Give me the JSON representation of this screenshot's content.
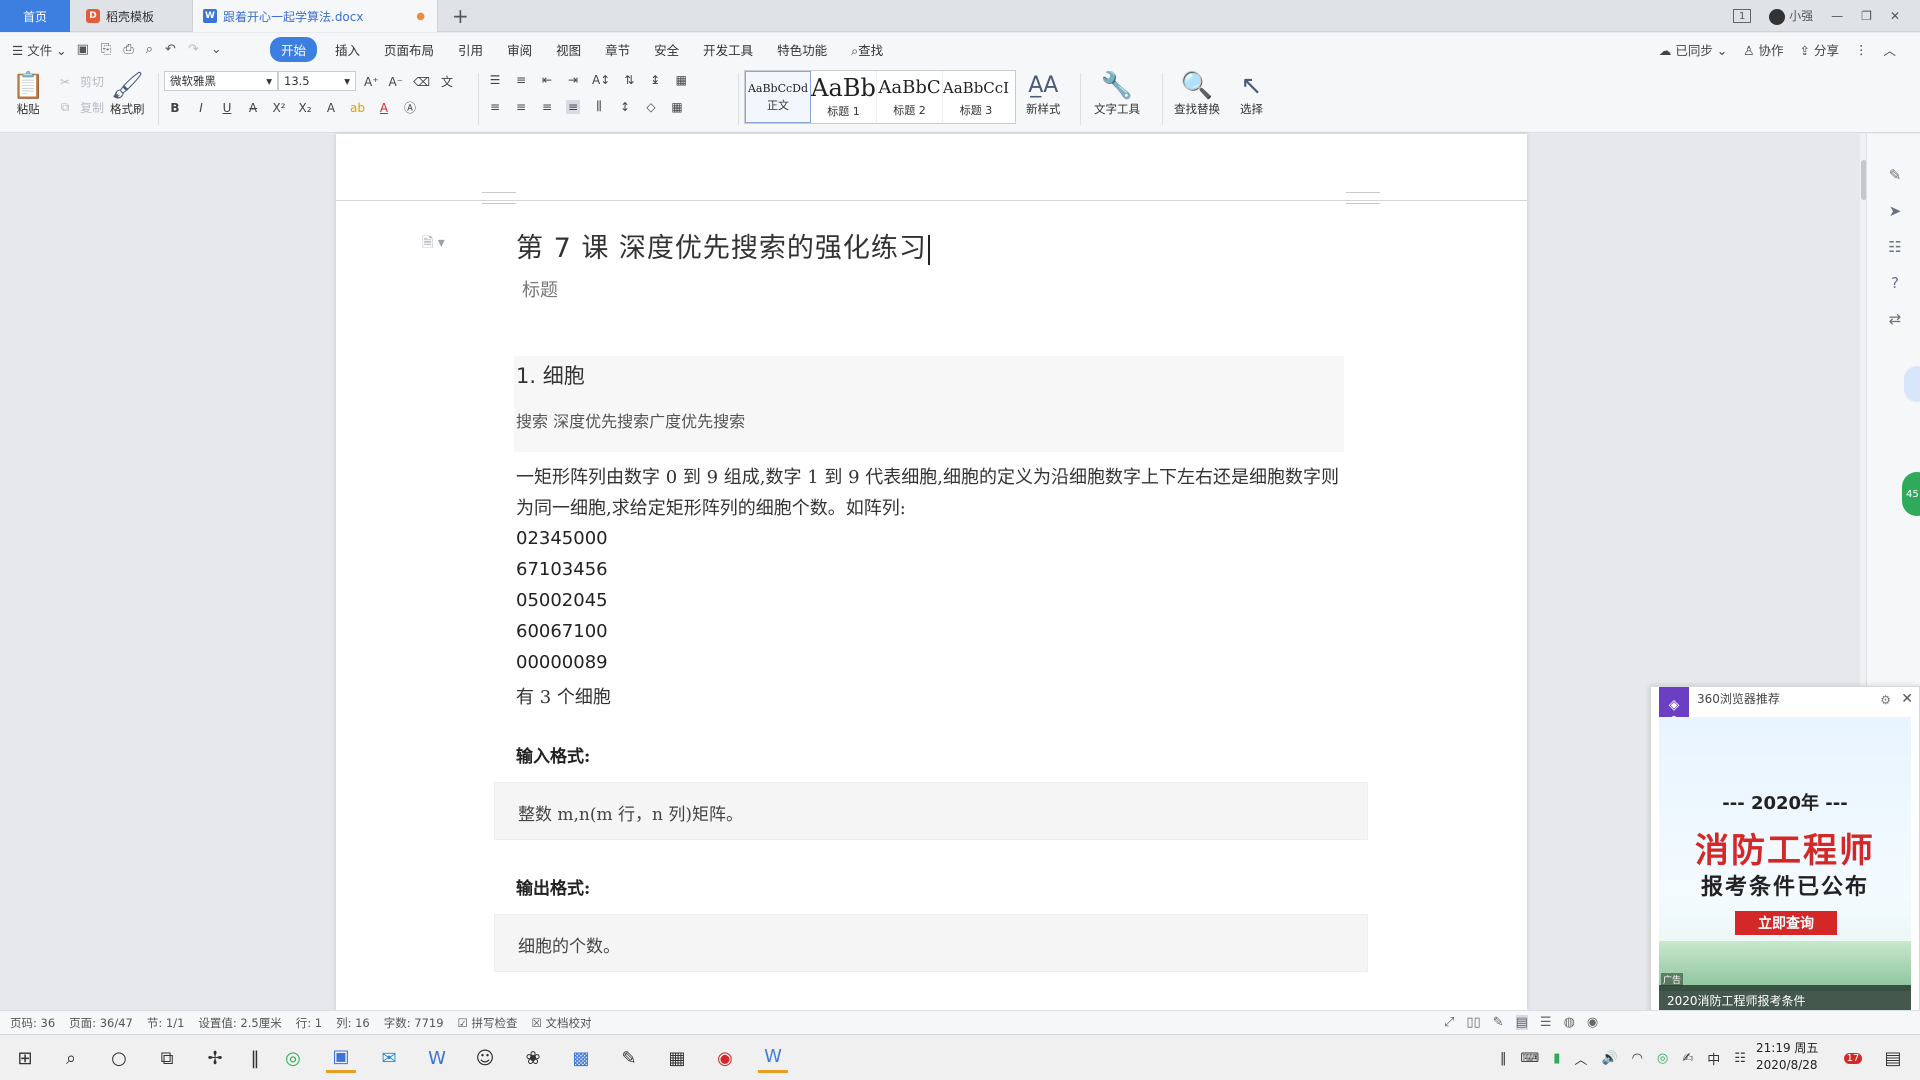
{
  "tabs": {
    "home": "首页",
    "template": "稻壳模板",
    "doc": "跟着开心一起学算法.docx",
    "user": "小强",
    "page_badge": "1"
  },
  "menu": {
    "file": "文件",
    "items": [
      "开始",
      "插入",
      "页面布局",
      "引用",
      "审阅",
      "视图",
      "章节",
      "安全",
      "开发工具",
      "特色功能"
    ],
    "search": "查找",
    "synced": "已同步",
    "collab": "协作",
    "share": "分享"
  },
  "ribbon": {
    "paste": "粘贴",
    "cut": "剪切",
    "copy": "复制",
    "format_painter": "格式刷",
    "font_name": "微软雅黑",
    "font_size": "13.5",
    "styles": [
      {
        "preview": "AaBbCcDd",
        "name": "正文"
      },
      {
        "preview": "AaBb",
        "name": "标题 1"
      },
      {
        "preview": "AaBbC",
        "name": "标题 2"
      },
      {
        "preview": "AaBbCcI",
        "name": "标题 3"
      }
    ],
    "new_style": "新样式",
    "text_tools": "文字工具",
    "find_replace": "查找替换",
    "select": "选择"
  },
  "document": {
    "title": "第 7 课  深度优先搜索的强化练习",
    "title_hint": "标题",
    "section_title": "1.  细胞",
    "section_tags": "搜索 深度优先搜索广度优先搜索",
    "paragraph": "一矩形阵列由数字 0 到 9 组成,数字 1 到 9 代表细胞,细胞的定义为沿细胞数字上下左右还是细胞数字则为同一细胞,求给定矩形阵列的细胞个数。如阵列:",
    "matrix": [
      "02345000",
      "67103456",
      "05002045",
      "60067100",
      "00000089"
    ],
    "result": "有 3 个细胞",
    "input_label": "输入格式:",
    "input_text": "整数 m,n(m 行，n 列)矩阵。",
    "output_label": "输出格式:",
    "output_text": "细胞的个数。"
  },
  "ad": {
    "source": "360浏览器推荐",
    "year": "--- 2020年 ---",
    "headline": "消防工程师",
    "subline": "报考条件已公布",
    "button": "立即查询",
    "tag": "广告",
    "caption": "2020消防工程师报考条件"
  },
  "status": {
    "page_no": "页码: 36",
    "pages": "页面: 36/47",
    "section": "节: 1/1",
    "setting": "设置值: 2.5厘米",
    "row": "行: 1",
    "col": "列: 16",
    "words": "字数: 7719",
    "spell": "拼写检查",
    "proof": "文档校对"
  },
  "taskbar": {
    "ime": "中",
    "time": "21:19 周五",
    "date": "2020/8/28",
    "notif": "17"
  },
  "colors": {
    "accent": "#3d7fe0",
    "ad_red": "#d42828",
    "float_green": "#2eaa5a"
  }
}
